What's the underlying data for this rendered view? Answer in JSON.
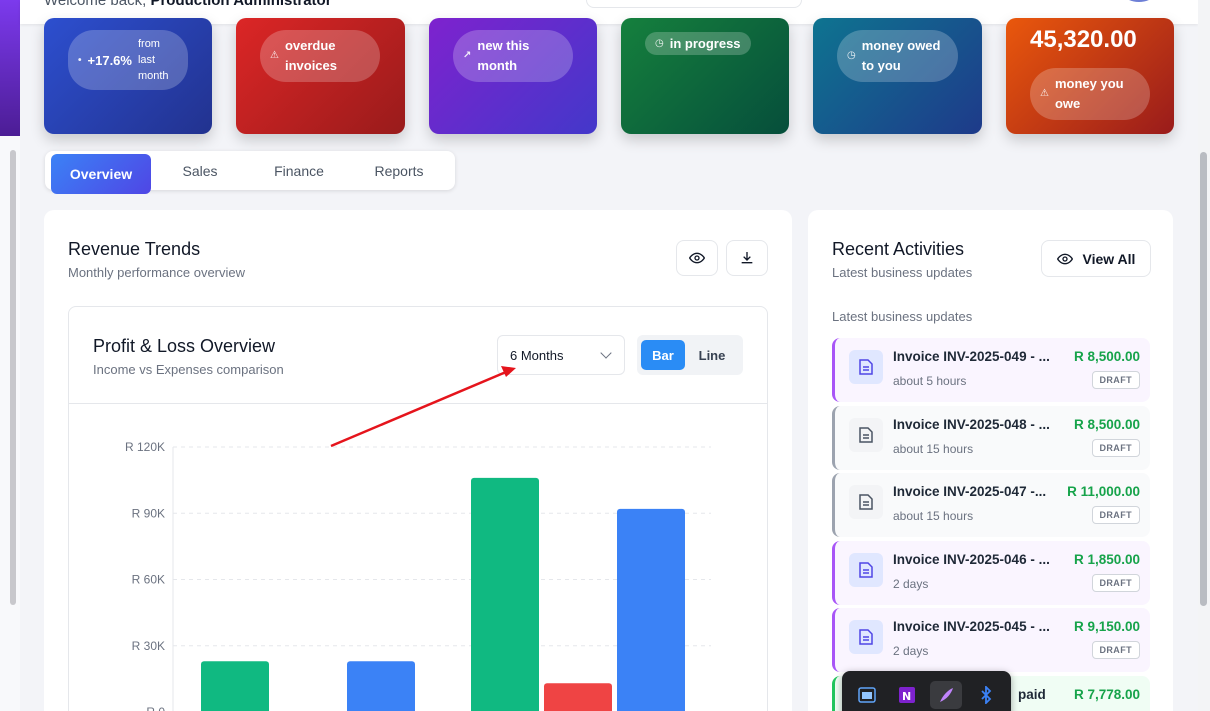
{
  "header": {
    "welcome_prefix": "Welcome back,",
    "user": "Production Administrator"
  },
  "stats": [
    {
      "pill_value": "+17.6%",
      "pill_text": "from last month",
      "colors": [
        "#2d4fcf",
        "#22328f"
      ]
    },
    {
      "pill_text": "overdue invoices",
      "icon": "warning-icon",
      "colors": [
        "#dc2626",
        "#991b1b"
      ]
    },
    {
      "pill_text": "new this month",
      "icon": "trending-up-icon",
      "colors": [
        "#7e22ce",
        "#4338ca"
      ]
    },
    {
      "pill_text": "in progress",
      "icon": "clock-icon",
      "colors": [
        "#15803d",
        "#064e3b"
      ]
    },
    {
      "pill_text": "money owed to you",
      "icon": "clock-icon",
      "colors": [
        "#0e7490",
        "#1e3a8a"
      ]
    },
    {
      "value": "45,320.00",
      "pill_text": "money you owe",
      "icon": "warning-icon",
      "colors": [
        "#ea580c",
        "#991b1b"
      ]
    }
  ],
  "tabs": [
    "Overview",
    "Sales",
    "Finance",
    "Reports"
  ],
  "revenue": {
    "title": "Revenue Trends",
    "subtitle": "Monthly performance overview"
  },
  "profit_loss": {
    "title": "Profit & Loss Overview",
    "subtitle": "Income vs Expenses comparison",
    "period": "6 Months",
    "toggle": {
      "bar": "Bar",
      "line": "Line"
    }
  },
  "chart_data": {
    "type": "bar",
    "ytick_labels": [
      "R 120K",
      "R 90K",
      "R 60K",
      "R 30K",
      "R 0"
    ],
    "ylim": [
      0,
      120000
    ],
    "grid": true,
    "bars": [
      {
        "value": 23000,
        "color": "#10b981"
      },
      {
        "value": 23000,
        "color": "#3b82f6"
      },
      {
        "value": 106000,
        "color": "#10b981"
      },
      {
        "value": 13000,
        "color": "#ef4444"
      },
      {
        "value": 92000,
        "color": "#3b82f6"
      }
    ]
  },
  "activities": {
    "title": "Recent Activities",
    "subtitle": "Latest business updates",
    "section_label": "Latest business updates",
    "view_all": "View All",
    "items": [
      {
        "title": "Invoice INV-2025-049 - ...",
        "amount": "R 8,500.00",
        "time": "about 5 hours",
        "badge": "DRAFT",
        "accent": "#a855f7",
        "bg": "#faf5ff"
      },
      {
        "title": "Invoice INV-2025-048 - ...",
        "amount": "R 8,500.00",
        "time": "about 15 hours",
        "badge": "DRAFT",
        "accent": "#9ca3af",
        "bg": "#f9fafb"
      },
      {
        "title": "Invoice INV-2025-047 -...",
        "amount": "R 11,000.00",
        "time": "about 15 hours",
        "badge": "DRAFT",
        "accent": "#9ca3af",
        "bg": "#f9fafb"
      },
      {
        "title": "Invoice INV-2025-046 - ...",
        "amount": "R 1,850.00",
        "time": "2 days",
        "badge": "DRAFT",
        "accent": "#a855f7",
        "bg": "#faf5ff"
      },
      {
        "title": "Invoice INV-2025-045 - ...",
        "amount": "R 9,150.00",
        "time": "2 days",
        "badge": "DRAFT",
        "accent": "#a855f7",
        "bg": "#faf5ff"
      },
      {
        "title": "paid",
        "amount": "R 7,778.00",
        "accent": "#22c55e",
        "bg": "#f0fdf4"
      }
    ]
  },
  "taskbar": {
    "icons": [
      "app-window-icon",
      "onenote-icon",
      "feather-icon",
      "bluetooth-icon"
    ]
  }
}
